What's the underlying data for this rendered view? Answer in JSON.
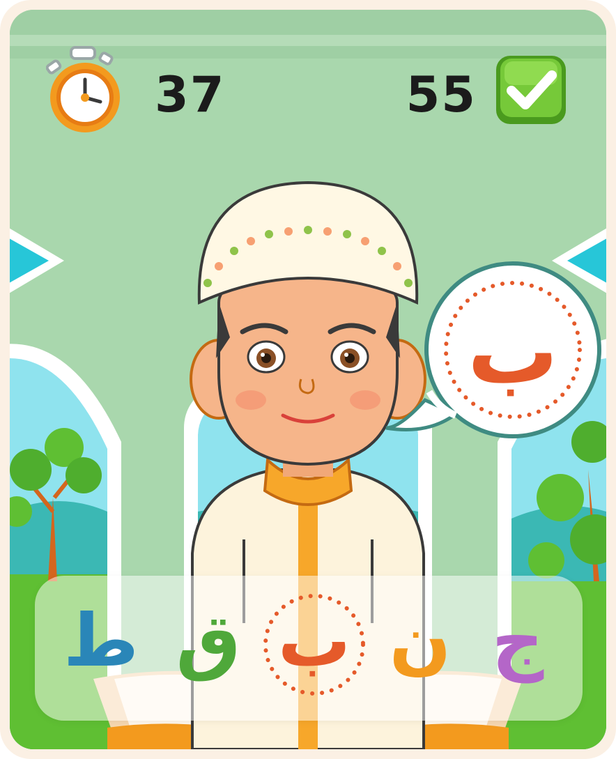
{
  "hud": {
    "timer_value": "37",
    "score_value": "55",
    "timer_icon": "stopwatch-icon",
    "score_icon": "checkmark-icon"
  },
  "prompt": {
    "letter": "ب",
    "letter_color": "#e55a2a"
  },
  "options": [
    {
      "letter": "ط",
      "color": "#2a86b8",
      "selected": false
    },
    {
      "letter": "ق",
      "color": "#4fa83a",
      "selected": false
    },
    {
      "letter": "ب",
      "color": "#e55a2a",
      "selected": true
    },
    {
      "letter": "ن",
      "color": "#f39a1e",
      "selected": false
    },
    {
      "letter": "ج",
      "color": "#b466c8",
      "selected": false
    }
  ],
  "colors": {
    "wall": "#a9d7ad",
    "sky": "#8fe3ee",
    "grass": "#5fbf33",
    "accent_orange": "#f39a1e",
    "check_green": "#5cb82a"
  }
}
